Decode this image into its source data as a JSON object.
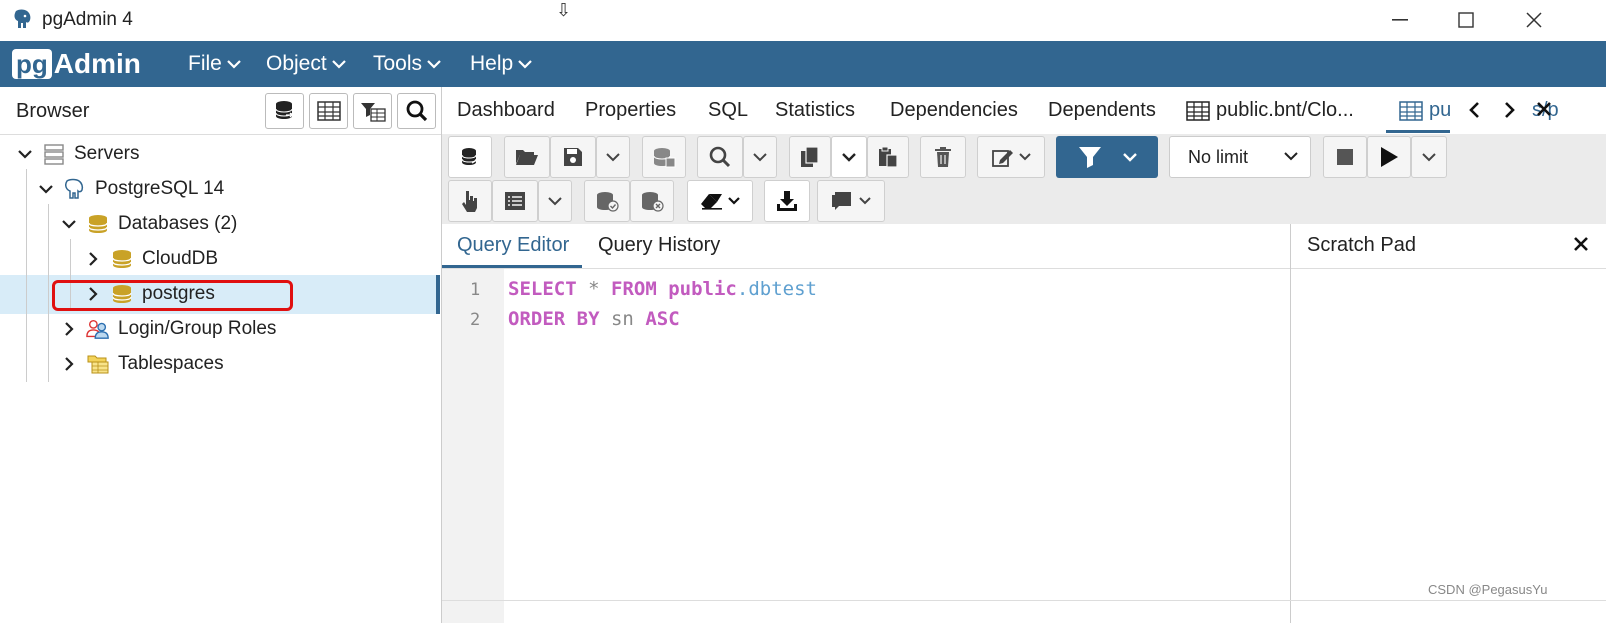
{
  "window": {
    "title": "pgAdmin 4",
    "minimize": "—",
    "maximize": "☐",
    "close": "✕"
  },
  "menubar": {
    "logo_pg": "pg",
    "logo_admin": "Admin",
    "menus": [
      "File",
      "Object",
      "Tools",
      "Help"
    ]
  },
  "browser": {
    "title": "Browser",
    "toolbar_icons": [
      "database-query-icon",
      "table-grid-icon",
      "filter-table-icon",
      "search-icon"
    ],
    "tree": [
      {
        "label": "Servers",
        "icon": "servers-icon",
        "expanded": true
      },
      {
        "label": "PostgreSQL 14",
        "icon": "elephant-icon",
        "expanded": true
      },
      {
        "label": "Databases (2)",
        "icon": "databases-icon",
        "expanded": true
      },
      {
        "label": "CloudDB",
        "icon": "database-icon",
        "expanded": false
      },
      {
        "label": "postgres",
        "icon": "database-icon",
        "expanded": false,
        "selected": true
      },
      {
        "label": "Login/Group Roles",
        "icon": "roles-icon",
        "expanded": false
      },
      {
        "label": "Tablespaces",
        "icon": "tablespaces-icon",
        "expanded": false
      }
    ]
  },
  "tabs": {
    "items": [
      "Dashboard",
      "Properties",
      "SQL",
      "Statistics",
      "Dependencies",
      "Dependents",
      "public.bnt/Clo...",
      "pu",
      "s/p"
    ],
    "active": "pu"
  },
  "toolbar": {
    "limit_value": "No limit"
  },
  "editor": {
    "tabs": [
      "Query Editor",
      "Query History"
    ],
    "active_tab": "Query Editor",
    "lines": [
      {
        "num": "1",
        "tokens": [
          "SELECT",
          "*",
          "FROM",
          "public",
          ".",
          "dbtest"
        ]
      },
      {
        "num": "2",
        "tokens": [
          "ORDER BY",
          "sn",
          "ASC"
        ]
      }
    ]
  },
  "scratch_pad": {
    "title": "Scratch Pad",
    "close": "✕"
  },
  "watermark": "CSDN @PegasusYu",
  "colors": {
    "brand": "#326690",
    "selection": "#d8ecf8",
    "highlight_box": "#e01010",
    "keyword": "#c25bbf"
  }
}
